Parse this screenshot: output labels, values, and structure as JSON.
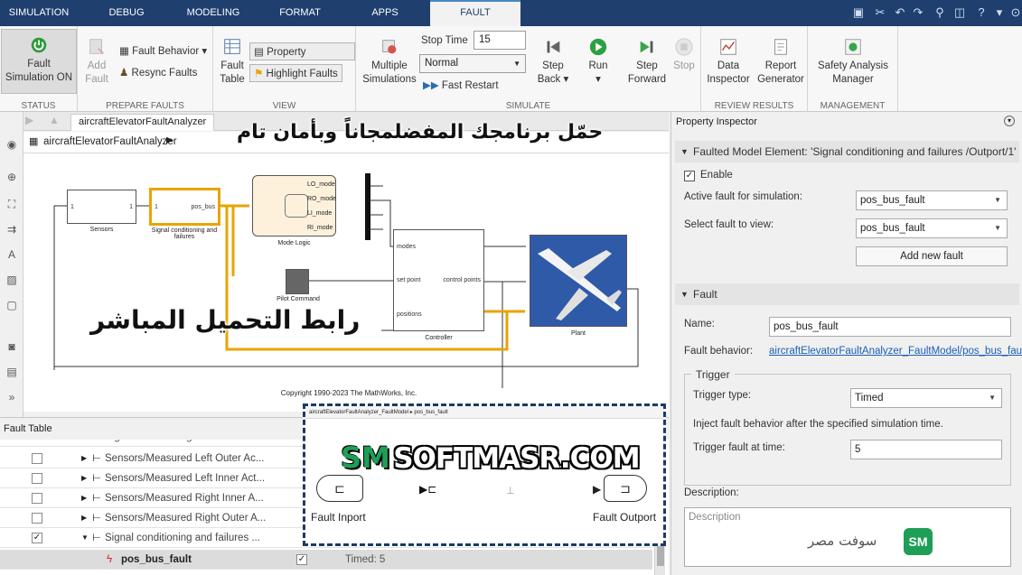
{
  "tabs": [
    "SIMULATION",
    "DEBUG",
    "MODELING",
    "FORMAT",
    "APPS",
    "FAULT ANALYZER"
  ],
  "active_tab_close": "×",
  "ribbon": {
    "status": {
      "button": "Fault Simulation ON",
      "label": "STATUS"
    },
    "prepare": {
      "add_fault": "Add Fault",
      "fault_behavior": "Fault Behavior",
      "resync": "Resync Faults",
      "label": "PREPARE FAULTS"
    },
    "view": {
      "fault_table": "Fault Table",
      "property_inspector": "Property Inspector",
      "highlight": "Highlight Faults",
      "label": "VIEW"
    },
    "simulate": {
      "multiple": "Multiple Simulations",
      "stop_time_label": "Stop Time",
      "stop_time_value": "15",
      "mode": "Normal",
      "fast_restart": "Fast Restart",
      "step_back": "Step Back",
      "run": "Run",
      "step_forward": "Step Forward",
      "stop": "Stop",
      "label": "SIMULATE"
    },
    "review": {
      "data_inspector": "Data Inspector",
      "report": "Report Generator",
      "label": "REVIEW RESULTS"
    },
    "management": {
      "safety": "Safety Analysis Manager",
      "label": "MANAGEMENT"
    }
  },
  "model_tab": "aircraftElevatorFaultAnalyzer",
  "breadcrumb": "aircraftElevatorFaultAnalyzer",
  "diagram": {
    "sensors": "Sensors",
    "signal": "Signal conditioning and failures",
    "mode_logic": "Mode Logic",
    "pilot": "Pilot Command",
    "controller": "Controller",
    "plant": "Plant",
    "pos_bus": "pos_bus",
    "port_1": "1",
    "modes": [
      "LO_mode",
      "RO_mode",
      "LI_mode",
      "RI_mode"
    ],
    "ctrl_ports": [
      "modes",
      "set point",
      "positions"
    ],
    "ctrl_out": "control points",
    "copyright": "Copyright 1990-2023 The MathWorks, Inc."
  },
  "fault_table": {
    "title": "Fault Table",
    "rows": [
      {
        "name": "Signal conditioning and failures ...",
        "checked": false
      },
      {
        "name": "Sensors/Measured Left Outer Ac...",
        "checked": false
      },
      {
        "name": "Sensors/Measured Left Inner Act...",
        "checked": false
      },
      {
        "name": "Sensors/Measured Right Inner A...",
        "checked": false
      },
      {
        "name": "Sensors/Measured Right Outer A...",
        "checked": false
      },
      {
        "name": "Signal conditioning and failures ...",
        "checked": true
      }
    ],
    "fault_row": {
      "name": "pos_bus_fault",
      "checked": true,
      "trigger": "Timed: 5"
    }
  },
  "inspector": {
    "title": "Property Inspector",
    "faulted_section": "Faulted Model Element: 'Signal conditioning and failures /Outport/1'",
    "enable": "Enable",
    "active_label": "Active fault for simulation:",
    "active_value": "pos_bus_fault",
    "select_label": "Select fault to view:",
    "select_value": "pos_bus_fault",
    "add_button": "Add new fault",
    "fault_section": "Fault",
    "name_label": "Name:",
    "name_value": "pos_bus_fault",
    "behavior_label": "Fault behavior:",
    "behavior_link": "aircraftElevatorFaultAnalyzer_FaultModel/pos_bus_fault",
    "trigger_title": "Trigger",
    "trigger_type_label": "Trigger type:",
    "trigger_type_value": "Timed",
    "trigger_info": "Inject fault behavior after the specified simulation time.",
    "trigger_time_label": "Trigger fault at time:",
    "trigger_time_value": "5",
    "description_label": "Description:",
    "description_placeholder": "Description"
  },
  "fault_model": {
    "breadcrumb": "aircraftElevatorFaultAnalyzer_FaultModel ▸ pos_bus_fault",
    "inport": "Fault Inport",
    "outport": "Fault Outport"
  },
  "overlays": {
    "download_free": "حمّل برنامجك المفضلمجاناً وبأمان تام",
    "direct_link": "رابط التحميل المباشر",
    "softmasr_badge": "SM",
    "softmasr_url": "SOFTMASR.COM",
    "logo_text": "سوفت مصر",
    "logo_badge": "SM"
  },
  "colors": {
    "ribbon_dark": "#1f3f6e",
    "highlight": "#e8a400",
    "brand_green": "#1e9e57",
    "link": "#1a5fb4"
  }
}
